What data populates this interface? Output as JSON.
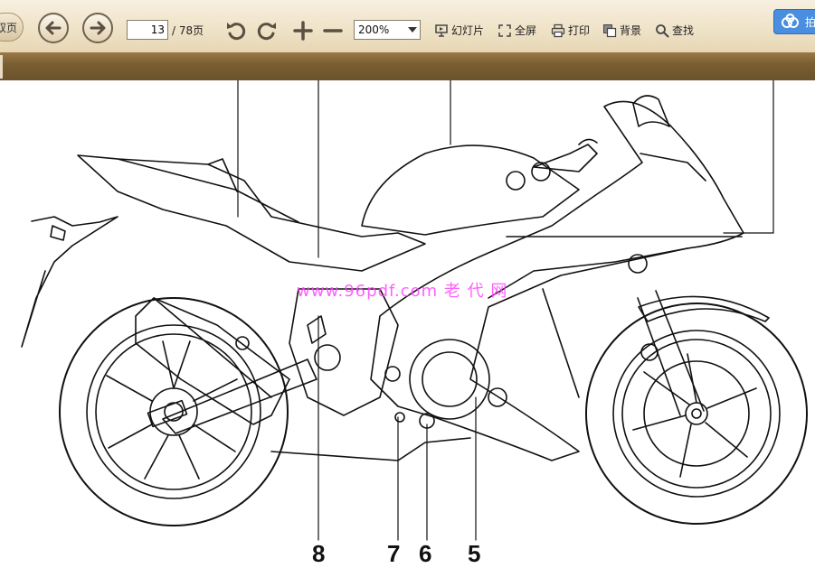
{
  "toolbar": {
    "prev_mode_label": "双页",
    "page_current": "13",
    "page_total": "/ 78页",
    "zoom_value": "200%",
    "slideshow_label": "幻灯片",
    "fullscreen_label": "全屏",
    "print_label": "打印",
    "background_label": "背景",
    "find_label": "查找",
    "cloud_label": "拍"
  },
  "content": {
    "watermark": "www.96pdf.com 老 代 网",
    "callouts": [
      "8",
      "7",
      "6",
      "5"
    ]
  },
  "colors": {
    "toolbar_bg": "#efe3c8",
    "divider_bg": "#7b5f33",
    "watermark": "#ff44ff",
    "cloud_button": "#4a8ee0"
  },
  "icons": [
    "back-arrow-icon",
    "forward-arrow-icon",
    "rotate-left-icon",
    "rotate-right-icon",
    "zoom-in-icon",
    "zoom-out-icon",
    "slideshow-icon",
    "fullscreen-icon",
    "print-icon",
    "background-icon",
    "search-icon",
    "cloud-icon"
  ]
}
